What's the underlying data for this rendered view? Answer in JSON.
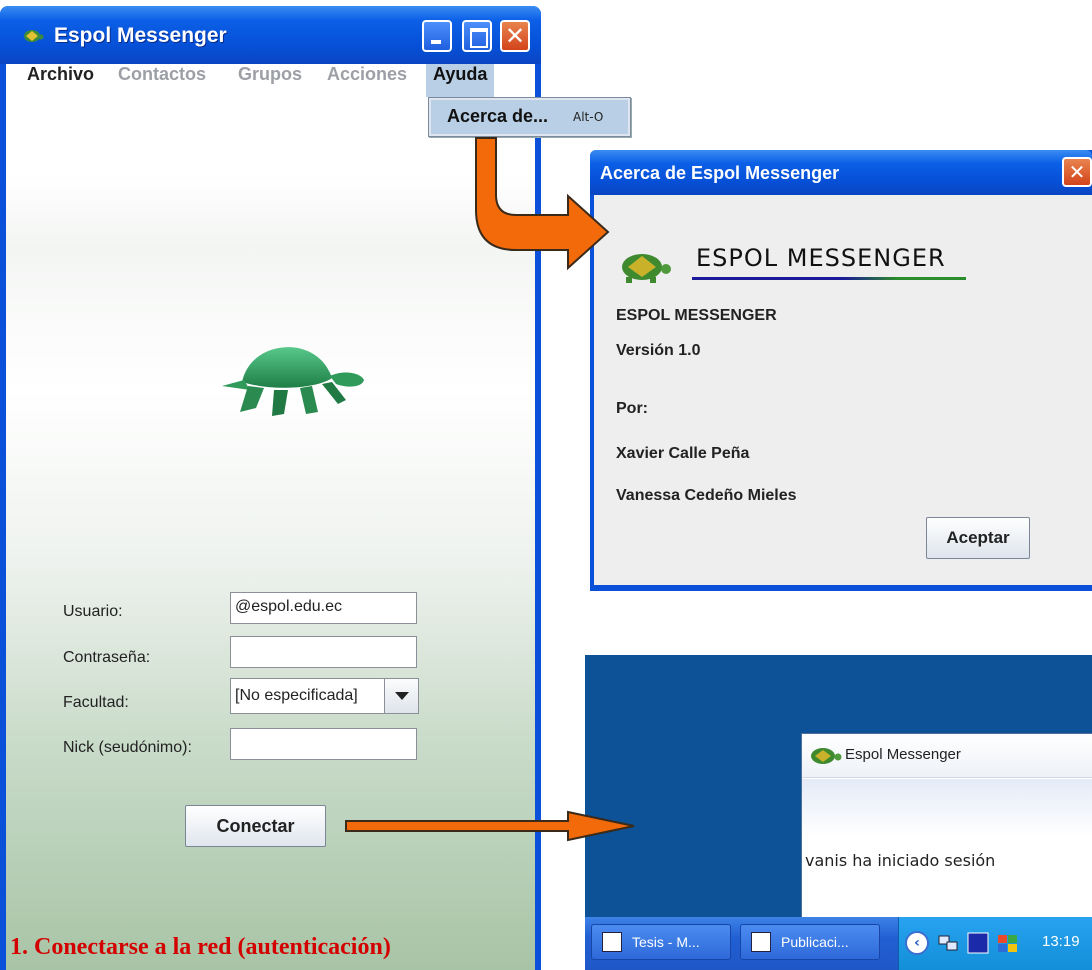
{
  "main_window": {
    "title": "Espol Messenger",
    "menu": [
      {
        "label": "Archivo"
      },
      {
        "label": "Contactos"
      },
      {
        "label": "Grupos"
      },
      {
        "label": "Acciones"
      },
      {
        "label": "Ayuda"
      }
    ],
    "dropdown": {
      "label": "Acerca de...",
      "accelerator": "Alt-O"
    },
    "form": {
      "usuario_label": "Usuario:",
      "usuario_value": "@espol.edu.ec",
      "password_label": "Contraseña:",
      "password_value": "",
      "facultad_label": "Facultad:",
      "facultad_value": "[No especificada]",
      "nick_label": "Nick (seudónimo):",
      "nick_value": ""
    },
    "connect_button": "Conectar",
    "caption": "1. Conectarse a la red (autenticación)"
  },
  "about_dialog": {
    "title": "Acerca de Espol Messenger",
    "heading": "ESPOL MESSENGER",
    "product": "ESPOL MESSENGER",
    "version": "Versión 1.0",
    "by": "Por:",
    "author_1": "Xavier Calle Peña",
    "author_2": "Vanessa Cedeño Mieles",
    "ok_button": "Aceptar"
  },
  "notification": {
    "title": "Espol Messenger",
    "message": "vanis ha iniciado sesión"
  },
  "taskbar": {
    "tasks": [
      {
        "label": "Tesis - M...",
        "icon": "word-doc-icon"
      },
      {
        "label": "Publicaci...",
        "icon": "publisher-icon"
      }
    ],
    "clock": "13:19"
  },
  "colors": {
    "titlebar": "#0650d7",
    "arrow": "#f26a0a",
    "caption": "#d40000",
    "turtle": "#2e9a5a",
    "desktop": "#0d5196"
  }
}
